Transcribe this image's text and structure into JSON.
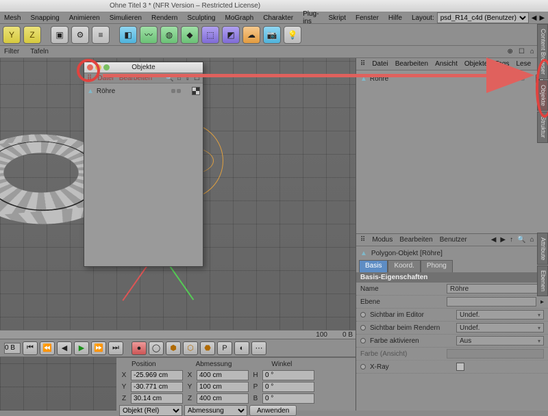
{
  "title": "Ohne Titel 3 * (NFR Version – Restricted License)",
  "menubar": [
    "Mesh",
    "Snapping",
    "Animieren",
    "Simulieren",
    "Rendern",
    "Sculpting",
    "MoGraph",
    "Charakter",
    "Plug-ins",
    "Skript",
    "Fenster",
    "Hilfe"
  ],
  "layout_label": "Layout:",
  "layout_value": "psd_R14_c4d (Benutzer)",
  "axis_buttons": [
    "Y",
    "Z"
  ],
  "subbar": {
    "left": [
      "Filter",
      "Tafeln"
    ],
    "right": [
      "⊕",
      "☐",
      "⌂",
      "□"
    ]
  },
  "object_manager": {
    "menus": [
      "Datei",
      "Bearbeiten",
      "Ansicht",
      "Objekte",
      "Tags",
      "Lese"
    ],
    "item": "Röhre"
  },
  "float_panel": {
    "title": "Objekte",
    "menus": [
      "Datei",
      "Bearbeiten"
    ],
    "menu_icons": [
      "🔍",
      "⌂",
      "⇧",
      "☐"
    ],
    "item": "Röhre"
  },
  "ruler": {
    "labels": [
      "100",
      "0 B"
    ]
  },
  "timeline_field": "0 B",
  "attributes": {
    "menus": [
      "Modus",
      "Bearbeiten",
      "Benutzer"
    ],
    "nav_icons": [
      "◀",
      "▶",
      "↑",
      "🔍",
      "⌂",
      "⊞"
    ],
    "object_title": "Polygon-Objekt [Röhre]",
    "tabs": [
      "Basis",
      "Koord.",
      "Phong"
    ],
    "section": "Basis-Eigenschaften",
    "rows": {
      "name": {
        "label": "Name",
        "value": "Röhre"
      },
      "ebene": {
        "label": "Ebene",
        "value": ""
      },
      "editor": {
        "label": "Sichtbar im Editor",
        "value": "Undef."
      },
      "render": {
        "label": "Sichtbar beim Rendern",
        "value": "Undef."
      },
      "farbe": {
        "label": "Farbe aktivieren",
        "value": "Aus"
      },
      "ansicht": {
        "label": "Farbe (Ansicht)",
        "value": ""
      },
      "xray": {
        "label": "X-Ray"
      }
    }
  },
  "coords": {
    "headers": [
      "Position",
      "Abmessung",
      "Winkel"
    ],
    "rows": [
      {
        "axis": "X",
        "pos": "-25.969 cm",
        "dim_axis": "X",
        "dim": "400 cm",
        "ang_axis": "H",
        "ang": "0 °"
      },
      {
        "axis": "Y",
        "pos": "-30.771 cm",
        "dim_axis": "Y",
        "dim": "100 cm",
        "ang_axis": "P",
        "ang": "0 °"
      },
      {
        "axis": "Z",
        "pos": "30.14 cm",
        "dim_axis": "Z",
        "dim": "400 cm",
        "ang_axis": "B",
        "ang": "0 °"
      }
    ],
    "sel1": "Objekt (Rel)",
    "sel2": "Abmessung",
    "apply": "Anwenden"
  },
  "side_tabs": [
    "Content Browser",
    "Objekte",
    "Struktur",
    "Attribute",
    "Ebenen"
  ]
}
